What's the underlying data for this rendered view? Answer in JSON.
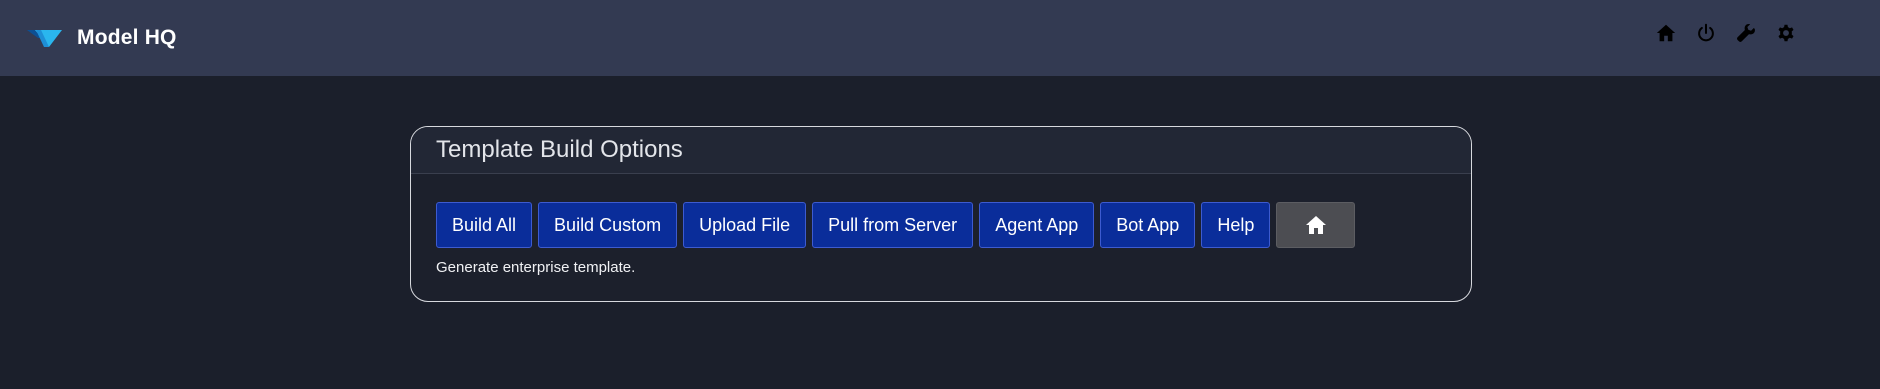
{
  "app": {
    "title": "Model HQ",
    "logo_icon": "model-hq-logo",
    "accent_colors": [
      "#1e8fd6",
      "#2ab6ee",
      "#0d4f93"
    ]
  },
  "header_icons": [
    {
      "name": "home-icon",
      "label": "home"
    },
    {
      "name": "power-icon",
      "label": "power"
    },
    {
      "name": "wrench-icon",
      "label": "tools"
    },
    {
      "name": "gear-icon",
      "label": "settings"
    }
  ],
  "panel": {
    "title": "Template Build Options",
    "buttons": [
      {
        "label": "Build All"
      },
      {
        "label": "Build Custom"
      },
      {
        "label": "Upload File"
      },
      {
        "label": "Pull from Server"
      },
      {
        "label": "Agent App"
      },
      {
        "label": "Bot App"
      },
      {
        "label": "Help"
      }
    ],
    "home_button_icon": "home-icon",
    "hint": "Generate enterprise template."
  },
  "colors": {
    "page_background": "#1b1f2b",
    "topbar_background": "#333a52",
    "button_primary": "#0a2d9a",
    "button_home": "#4c4d52"
  }
}
